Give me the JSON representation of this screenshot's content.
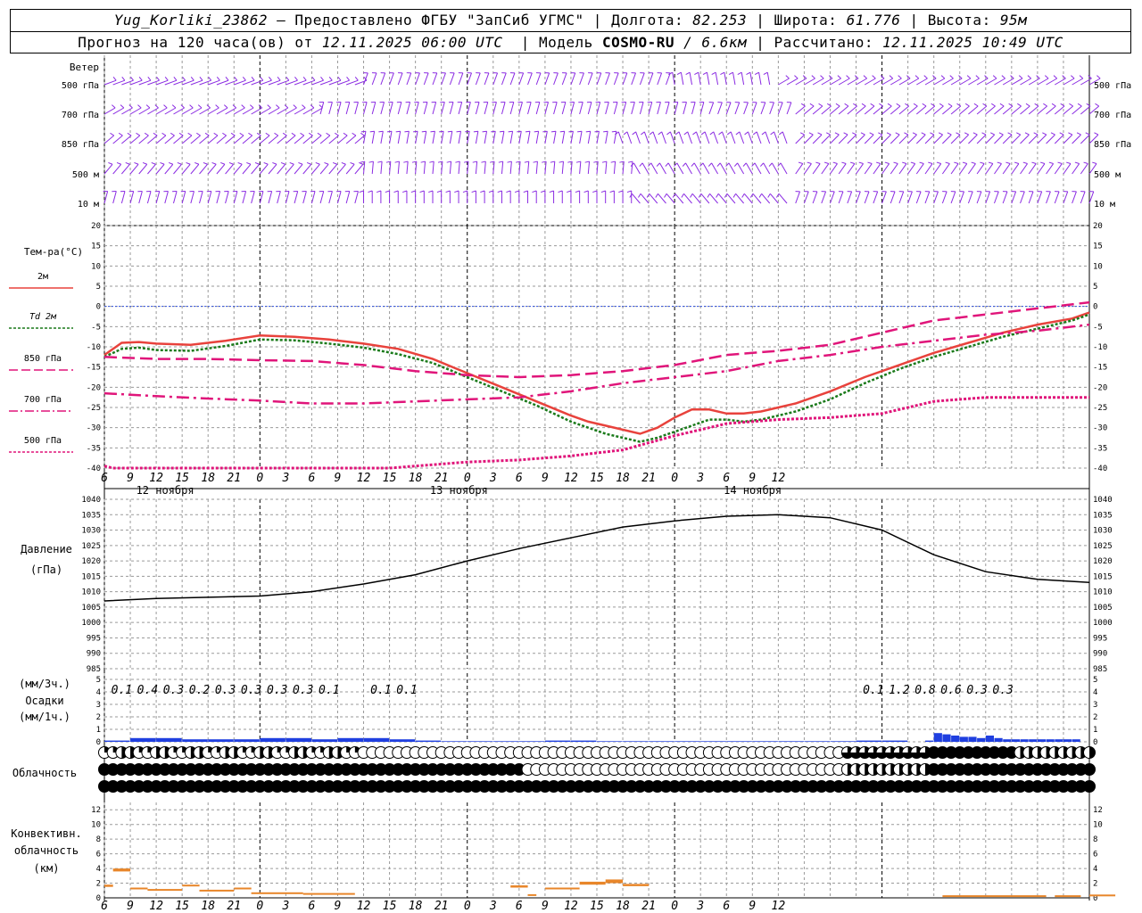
{
  "header": {
    "station": "Yug_Korliki_23862",
    "provider_text": "– Предоставлено ФГБУ \"ЗапСиб УГМС\"",
    "lon_label": "Долгота:",
    "lon_value": "82.253",
    "lat_label": "Широта:",
    "lat_value": "61.776",
    "alt_label": "Высота:",
    "alt_value": "95м",
    "forecast_label": "Прогноз на 120 часа(ов) от",
    "forecast_start": "12.11.2025 06:00 UTC",
    "model_label": "Модель",
    "model_name": "COSMO-RU",
    "model_res": "/ 6.6км",
    "calc_label": "Рассчитано:",
    "calc_time": "12.11.2025 10:49 UTC"
  },
  "colors": {
    "t2m": "#e8423c",
    "td2m": "#1a7a1a",
    "t850": "#e0157a",
    "t700": "#e0157a",
    "t500": "#e0157a",
    "wind": "#8a2be2",
    "pressure": "#000000",
    "precip": "#1f3fe0",
    "conv": "#e8862a",
    "grid": "#9a9a9a",
    "zero": "#3050e0"
  },
  "hour_labels": [
    "6",
    "9",
    "12",
    "15",
    "18",
    "21",
    "0",
    "3",
    "6",
    "9",
    "12",
    "15",
    "18",
    "21",
    "0",
    "3",
    "6",
    "9",
    "12",
    "15",
    "18",
    "21",
    "0",
    "3",
    "6",
    "9",
    "12"
  ],
  "day_labels": [
    "12 ноября",
    "13 ноября",
    "14 ноября"
  ],
  "wind": {
    "title": "Ветер",
    "levels": [
      "500 гПа",
      "700 гПа",
      "850 гПа",
      "500 м",
      "10 м"
    ]
  },
  "temperature": {
    "title": "Тем-ра(°C)",
    "legend": [
      "2м",
      "Td 2м",
      "850 гПа",
      "700 гПа",
      "500 гПа"
    ],
    "ticks": [
      "20",
      "15",
      "10",
      "5",
      "0",
      "-5",
      "-10",
      "-15",
      "-20",
      "-25",
      "-30",
      "-35",
      "-40"
    ]
  },
  "pressure": {
    "title": "Давление",
    "unit": "(гПа)",
    "ticks": [
      "1040",
      "1035",
      "1030",
      "1025",
      "1020",
      "1015",
      "1010",
      "1005",
      "1000",
      "995",
      "990",
      "985"
    ]
  },
  "precip": {
    "label1": "(мм/3ч.)",
    "label2": "Осадки",
    "label3": "(мм/1ч.)",
    "ticks": [
      "5",
      "4",
      "3",
      "2",
      "1",
      "0"
    ],
    "totals": [
      {
        "h": 7,
        "v": "0.1"
      },
      {
        "h": 10,
        "v": "0.4"
      },
      {
        "h": 13,
        "v": "0.3"
      },
      {
        "h": 16,
        "v": "0.2"
      },
      {
        "h": 19,
        "v": "0.3"
      },
      {
        "h": 22,
        "v": "0.3"
      },
      {
        "h": 25,
        "v": "0.3"
      },
      {
        "h": 28,
        "v": "0.3"
      },
      {
        "h": 31,
        "v": "0.1"
      },
      {
        "h": 37,
        "v": "0.1"
      },
      {
        "h": 40,
        "v": "0.1"
      },
      {
        "h": 94,
        "v": "0.1"
      },
      {
        "h": 97,
        "v": "1.2"
      },
      {
        "h": 100,
        "v": "0.8"
      },
      {
        "h": 103,
        "v": "0.6"
      },
      {
        "h": 106,
        "v": "0.3"
      },
      {
        "h": 109,
        "v": "0.3"
      }
    ]
  },
  "cloud": {
    "title": "Облачность",
    "rows_description": "upper/middle/lower cloud fraction circles"
  },
  "convective": {
    "title1": "Конвективн.",
    "title2": "облачность",
    "title3": "(км)",
    "ticks": [
      "12",
      "10",
      "8",
      "6",
      "4",
      "2",
      "0"
    ]
  },
  "chart_data": [
    {
      "type": "line",
      "title": "Тем-ра(°C)",
      "x_unit": "hours since 12.11.2025 06:00 UTC",
      "ylim": [
        -40,
        20
      ],
      "series": [
        {
          "name": "2м",
          "x": [
            0,
            2,
            4,
            6,
            10,
            14,
            18,
            22,
            26,
            30,
            34,
            38,
            42,
            46,
            50,
            54,
            56,
            58,
            62,
            64,
            66,
            68,
            70,
            72,
            74,
            76,
            78,
            80,
            84,
            88,
            92,
            96,
            100,
            104,
            108,
            112,
            114
          ],
          "values": [
            -12,
            -9,
            -8.8,
            -9.2,
            -9.5,
            -8.5,
            -7.2,
            -7.5,
            -8.2,
            -9.2,
            -10.5,
            -13,
            -16.5,
            -20,
            -23.5,
            -27,
            -28.5,
            -29.5,
            -31.5,
            -30,
            -27.5,
            -25.5,
            -25.5,
            -26.5,
            -26.5,
            -26,
            -25,
            -24,
            -21,
            -17.5,
            -14.5,
            -11.5,
            -9,
            -6.5,
            -4.5,
            -3,
            -1.5
          ]
        },
        {
          "name": "Td 2м",
          "x": [
            0,
            2,
            4,
            6,
            10,
            14,
            18,
            22,
            26,
            30,
            34,
            38,
            42,
            46,
            50,
            54,
            56,
            58,
            62,
            64,
            66,
            68,
            70,
            72,
            74,
            76,
            78,
            80,
            84,
            88,
            92,
            96,
            100,
            104,
            108,
            112,
            114
          ],
          "values": [
            -12.5,
            -10.5,
            -10.2,
            -10.8,
            -11,
            -9.8,
            -8.2,
            -8.4,
            -9.2,
            -10.2,
            -11.8,
            -14,
            -17.5,
            -21,
            -24.5,
            -28.5,
            -30,
            -31.5,
            -33.5,
            -32.5,
            -31,
            -29.5,
            -28,
            -28,
            -28.5,
            -28,
            -27,
            -26,
            -23,
            -19,
            -15.5,
            -12.5,
            -10,
            -7.5,
            -5.5,
            -3.5,
            -2
          ]
        },
        {
          "name": "850 гПа",
          "x": [
            0,
            6,
            12,
            18,
            24,
            30,
            36,
            42,
            48,
            54,
            60,
            66,
            72,
            78,
            84,
            90,
            96,
            102,
            108,
            114
          ],
          "values": [
            -12.5,
            -13,
            -13,
            -13.3,
            -13.5,
            -14.5,
            -16,
            -17,
            -17.5,
            -17,
            -16,
            -14.5,
            -12,
            -11,
            -9.5,
            -6.5,
            -3.5,
            -2,
            -0.5,
            1
          ]
        },
        {
          "name": "700 гПа",
          "x": [
            0,
            6,
            12,
            18,
            24,
            30,
            36,
            42,
            48,
            54,
            60,
            66,
            72,
            78,
            84,
            90,
            96,
            102,
            108,
            114
          ],
          "values": [
            -21.5,
            -22.2,
            -22.8,
            -23.3,
            -24,
            -24,
            -23.5,
            -23,
            -22.5,
            -21,
            -19,
            -17.5,
            -16,
            -13.5,
            -12,
            -10,
            -8.5,
            -7,
            -6,
            -4.5
          ]
        },
        {
          "name": "500 гПа",
          "x": [
            0,
            1,
            3,
            6,
            9,
            12,
            18,
            24,
            30,
            33,
            36,
            42,
            48,
            54,
            60,
            66,
            72,
            78,
            84,
            90,
            96,
            102,
            108,
            114
          ],
          "values": [
            -39.5,
            -40,
            -40.5,
            -40.8,
            -41,
            -41,
            -41,
            -41,
            -41,
            -40,
            -39.5,
            -38.5,
            -38,
            -37,
            -35.5,
            -32,
            -29,
            -28,
            -27.5,
            -26.5,
            -23.5,
            -22.5,
            -22.5,
            -22.5
          ]
        }
      ]
    },
    {
      "type": "line",
      "title": "Давление",
      "x_unit": "hours since 12.11.2025 06:00 UTC",
      "ylim": [
        985,
        1040
      ],
      "series": [
        {
          "name": "Давление",
          "x": [
            0,
            6,
            12,
            18,
            24,
            30,
            36,
            42,
            48,
            54,
            60,
            66,
            72,
            78,
            84,
            90,
            96,
            102,
            108,
            114
          ],
          "values": [
            1007,
            1007.8,
            1008.2,
            1008.6,
            1010,
            1012.5,
            1015.5,
            1020,
            1024,
            1027.5,
            1031,
            1033,
            1034.5,
            1035,
            1034,
            1030,
            1022,
            1016.5,
            1014,
            1013
          ]
        }
      ]
    },
    {
      "type": "bar",
      "title": "Осадки",
      "x_unit": "hours since 12.11.2025 06:00 UTC",
      "ylim": [
        0,
        5
      ],
      "series": [
        {
          "name": "(мм/1ч.)",
          "x": [
            3,
            6,
            9,
            12,
            15,
            18,
            21,
            24,
            27,
            30,
            33,
            36,
            39,
            42,
            45,
            48,
            51,
            54,
            57,
            60,
            63,
            66,
            69,
            72,
            75,
            78,
            81,
            84,
            87,
            90,
            93,
            96,
            97,
            98,
            99,
            100,
            101,
            102,
            103,
            104,
            105,
            106,
            107,
            108,
            109,
            110,
            111,
            112,
            113
          ],
          "values": [
            0.1,
            0.3,
            0.3,
            0.2,
            0.2,
            0.2,
            0.3,
            0.3,
            0.2,
            0.3,
            0.3,
            0.2,
            0.1,
            0.05,
            0.05,
            0.05,
            0.05,
            0.1,
            0.1,
            0.05,
            0.05,
            0.05,
            0.05,
            0.05,
            0.05,
            0.05,
            0.05,
            0.05,
            0.05,
            0.1,
            0.1,
            0.1,
            0.7,
            0.6,
            0.5,
            0.4,
            0.4,
            0.3,
            0.5,
            0.3,
            0.2,
            0.2,
            0.2,
            0.2,
            0.2,
            0.2,
            0.2,
            0.2,
            0.2
          ]
        }
      ]
    },
    {
      "type": "bar",
      "title": "Конвективн. облачность (км)",
      "x_unit": "hours since 12.11.2025 06:00 UTC",
      "ylim": [
        0,
        13
      ],
      "segments": [
        {
          "x0": 0,
          "x1": 1,
          "bottom": 1.5,
          "top": 1.8
        },
        {
          "x0": 1,
          "x1": 3,
          "bottom": 3.6,
          "top": 4.0
        },
        {
          "x0": 3,
          "x1": 5,
          "bottom": 1.2,
          "top": 1.4
        },
        {
          "x0": 5,
          "x1": 9,
          "bottom": 1.0,
          "top": 1.2
        },
        {
          "x0": 9,
          "x1": 11,
          "bottom": 1.6,
          "top": 1.8
        },
        {
          "x0": 11,
          "x1": 15,
          "bottom": 0.9,
          "top": 1.1
        },
        {
          "x0": 15,
          "x1": 17,
          "bottom": 1.2,
          "top": 1.4
        },
        {
          "x0": 17,
          "x1": 23,
          "bottom": 0.6,
          "top": 0.75
        },
        {
          "x0": 23,
          "x1": 29,
          "bottom": 0.5,
          "top": 0.65
        },
        {
          "x0": 47,
          "x1": 49,
          "bottom": 1.4,
          "top": 1.7
        },
        {
          "x0": 49,
          "x1": 50,
          "bottom": 0.3,
          "top": 0.5
        },
        {
          "x0": 51,
          "x1": 55,
          "bottom": 1.2,
          "top": 1.4
        },
        {
          "x0": 55,
          "x1": 58,
          "bottom": 1.8,
          "top": 2.2
        },
        {
          "x0": 58,
          "x1": 60,
          "bottom": 2.0,
          "top": 2.5
        },
        {
          "x0": 60,
          "x1": 63,
          "bottom": 1.6,
          "top": 1.9
        },
        {
          "x0": 97,
          "x1": 109,
          "bottom": 0.2,
          "top": 0.35
        },
        {
          "x0": 110,
          "x1": 113,
          "bottom": 0.2,
          "top": 0.35
        },
        {
          "x0": 114,
          "x1": 117,
          "bottom": 0.3,
          "top": 0.45
        }
      ]
    }
  ]
}
